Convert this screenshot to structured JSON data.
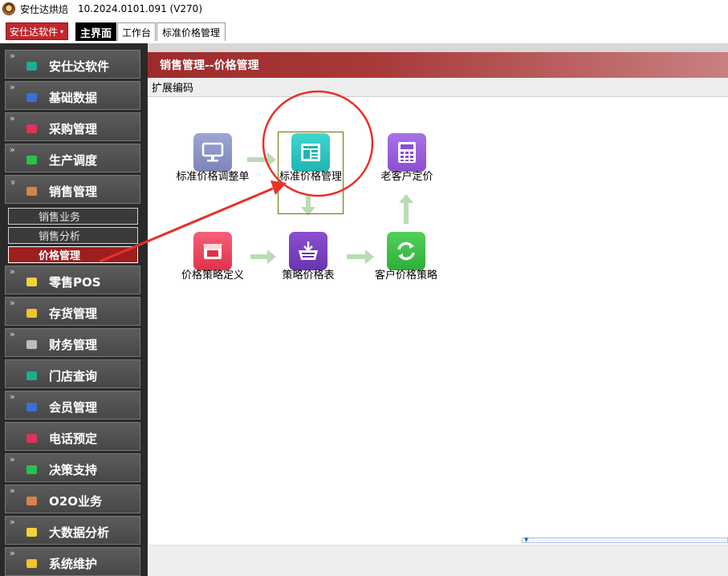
{
  "titlebar": {
    "app_name": "安仕达烘焙",
    "version": "10.2024.0101.091 (V270)"
  },
  "tabbar": {
    "company_label": "安仕达软件",
    "caret": "▾",
    "tabs": [
      {
        "label": "主界面",
        "active": true
      },
      {
        "label": "工作台",
        "active": false
      },
      {
        "label": "标准价格管理",
        "active": false
      }
    ]
  },
  "sidebar": {
    "chevron_collapsed": "»",
    "chevron_expanded": "»",
    "items": [
      {
        "label": "安仕达软件",
        "icon": "grid-icon",
        "color": "#1fae8e"
      },
      {
        "label": "基础数据",
        "icon": "database-icon",
        "color": "#3a6fd8"
      },
      {
        "label": "采购管理",
        "icon": "cart-icon",
        "color": "#e0325a"
      },
      {
        "label": "生产调度",
        "icon": "factory-icon",
        "color": "#27c24c"
      },
      {
        "label": "销售管理",
        "icon": "sales-icon",
        "color": "#d9834a",
        "expanded": true
      },
      {
        "label": "零售POS",
        "icon": "pos-icon",
        "color": "#f2d23a"
      },
      {
        "label": "存货管理",
        "icon": "inventory-icon",
        "color": "#f2c12e"
      },
      {
        "label": "财务管理",
        "icon": "finance-icon",
        "color": "#bdbdbd"
      },
      {
        "label": "门店查询",
        "icon": "store-icon",
        "color": "#1fae8e"
      },
      {
        "label": "会员管理",
        "icon": "member-icon",
        "color": "#3a6fd8"
      },
      {
        "label": "电话预定",
        "icon": "phone-icon",
        "color": "#e0325a"
      },
      {
        "label": "决策支持",
        "icon": "decision-icon",
        "color": "#27c24c"
      },
      {
        "label": "O2O业务",
        "icon": "o2o-icon",
        "color": "#d9834a"
      },
      {
        "label": "大数据分析",
        "icon": "bigdata-icon",
        "color": "#f2d23a"
      },
      {
        "label": "系统维护",
        "icon": "settings-icon",
        "color": "#f2c12e"
      }
    ],
    "sales_sub": [
      {
        "label": "销售业务",
        "active": false
      },
      {
        "label": "销售分析",
        "active": false
      },
      {
        "label": "价格管理",
        "active": true
      }
    ]
  },
  "main": {
    "panel_title": "销售管理--价格管理",
    "ext_label": "扩展编码",
    "nodes": [
      {
        "label": "标准价格调整单",
        "icon": "monitor-icon",
        "color": "#8e96c8"
      },
      {
        "label": "标准价格管理",
        "icon": "layout-icon",
        "color": "#2fc4c4"
      },
      {
        "label": "老客户定价",
        "icon": "calculator-icon",
        "color": "#9b5fd9"
      },
      {
        "label": "价格策略定义",
        "icon": "shop-icon",
        "color": "#f0465a"
      },
      {
        "label": "策略价格表",
        "icon": "basket-icon",
        "color": "#7a3fc4"
      },
      {
        "label": "客户价格策略",
        "icon": "refresh-icon",
        "color": "#3fbf4a"
      }
    ]
  },
  "annotation": {
    "color": "#e8312a"
  }
}
